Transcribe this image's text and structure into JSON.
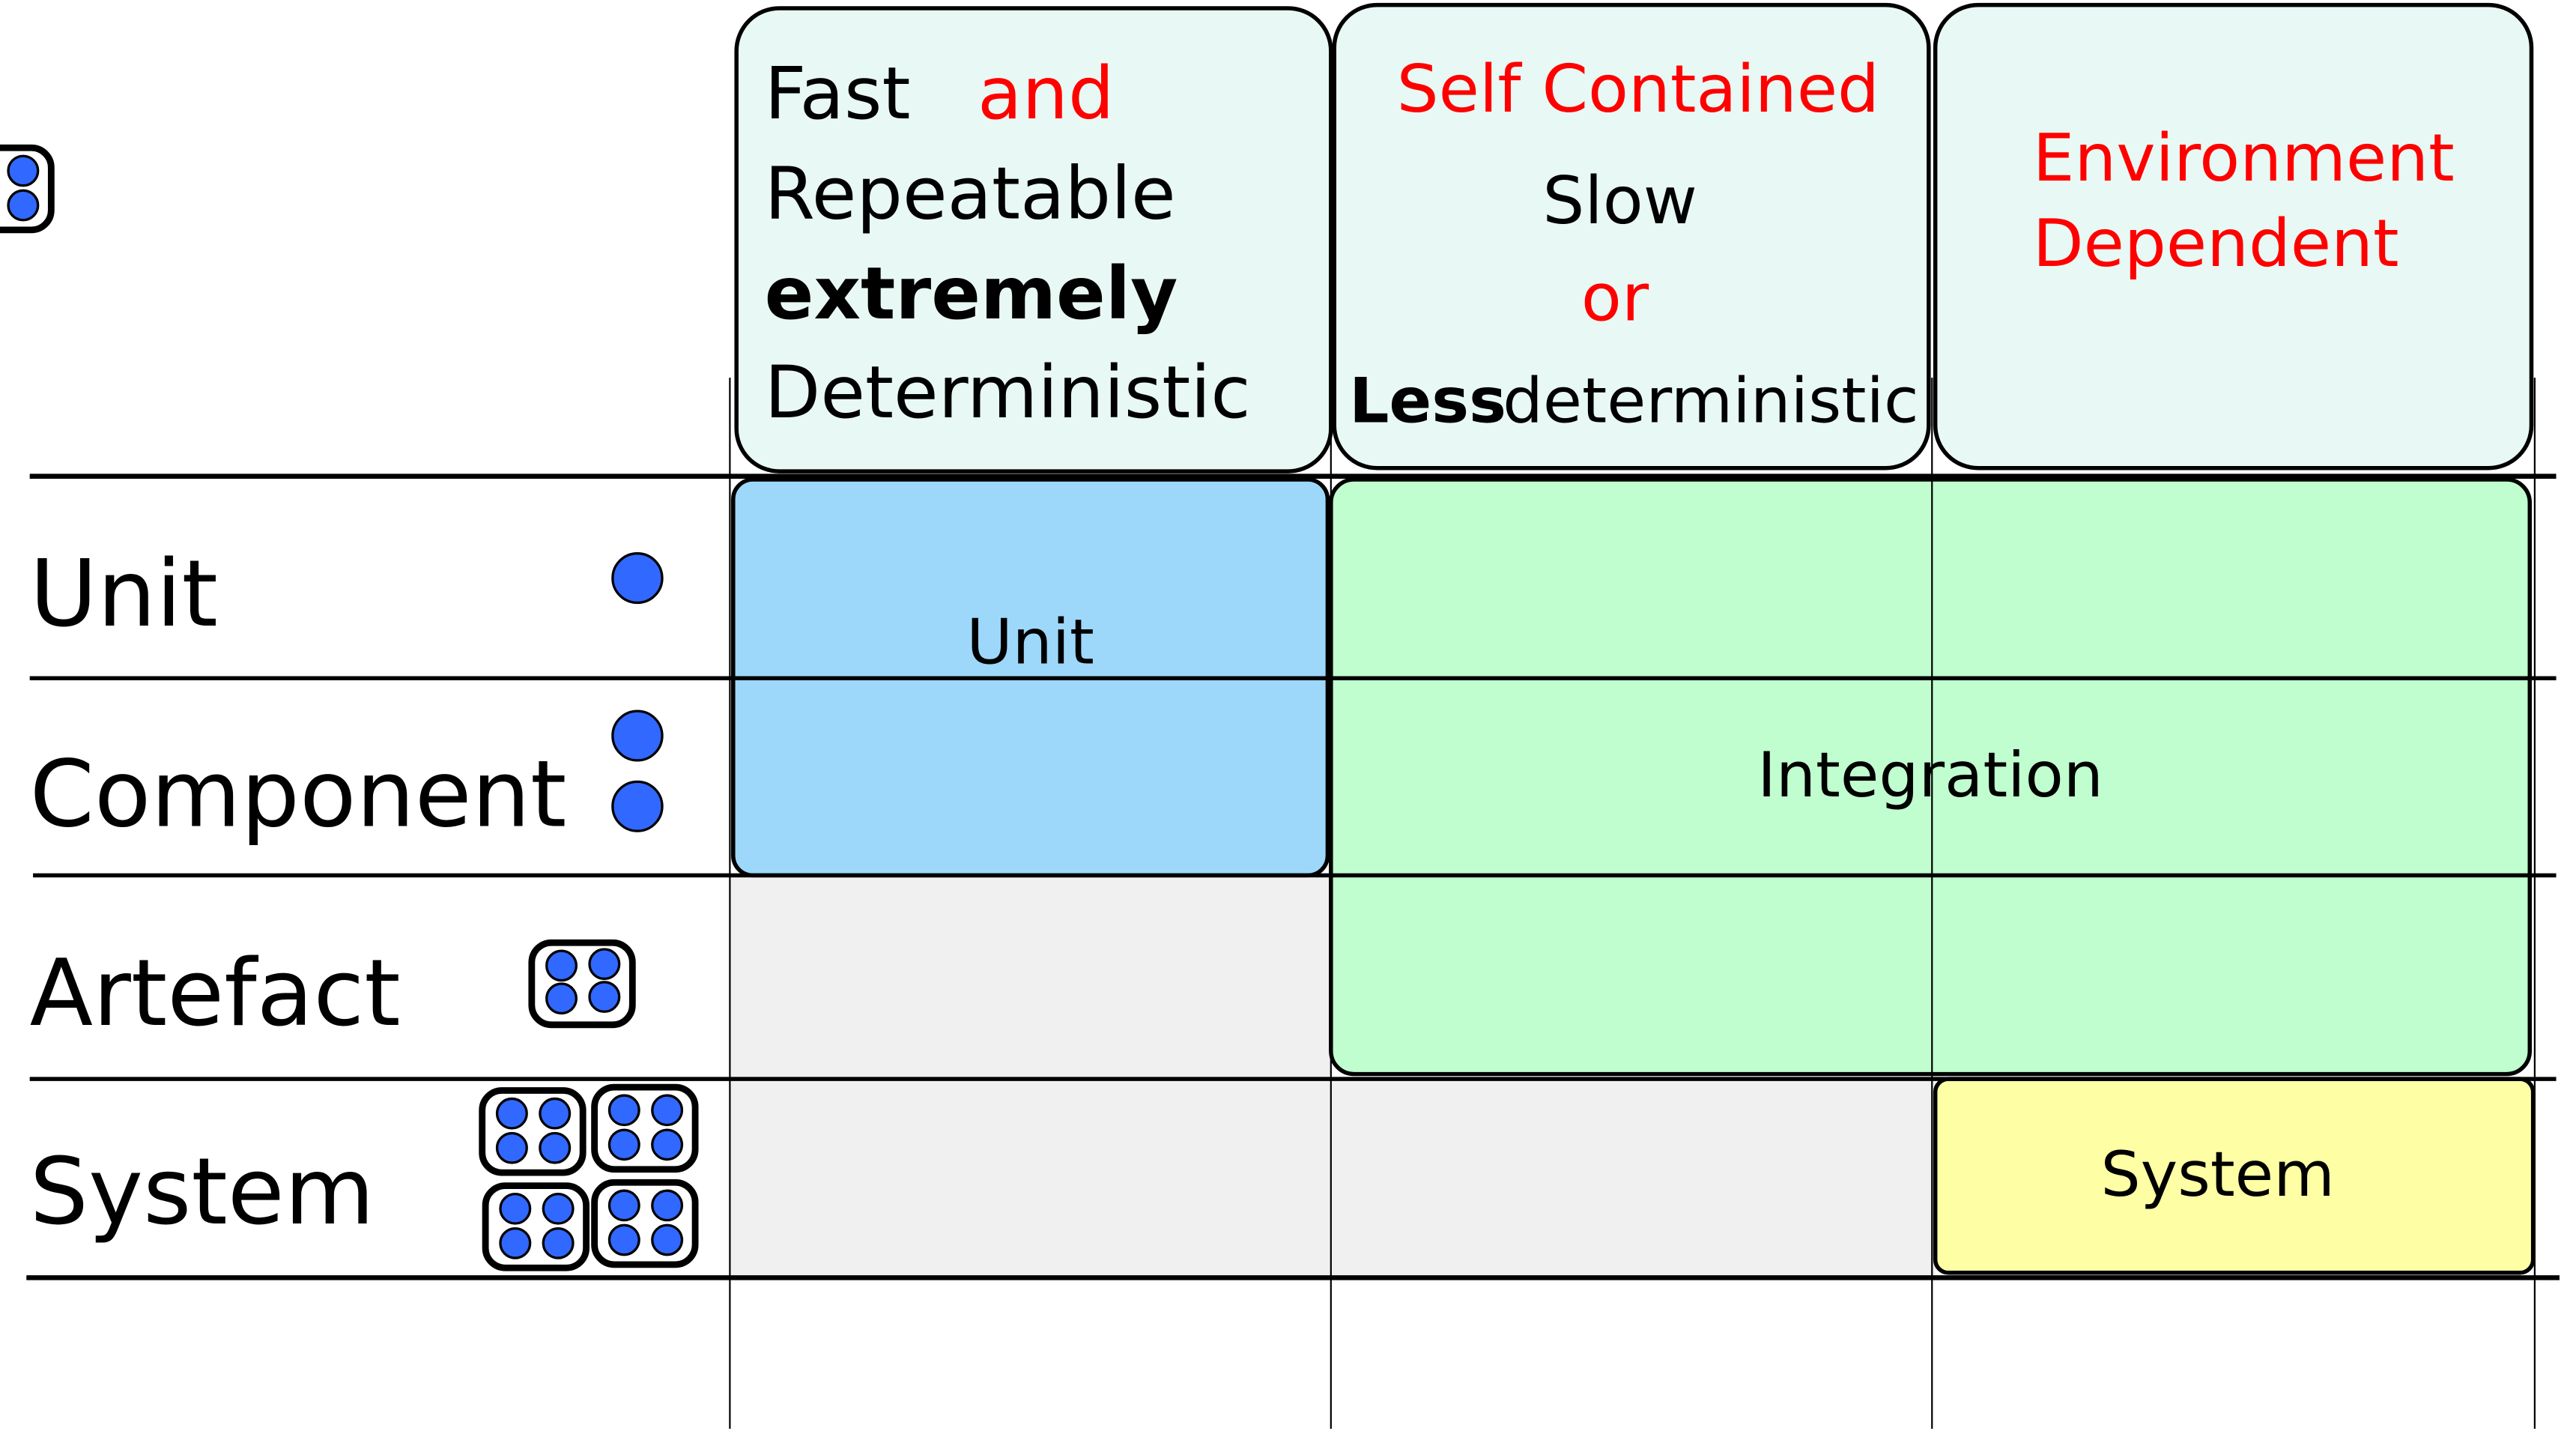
{
  "columns": [
    {
      "lines": [
        {
          "parts": [
            "Fast",
            "and"
          ]
        },
        {
          "parts": [
            "Repeatable"
          ]
        },
        {
          "parts": [
            "extremely"
          ]
        },
        {
          "parts": [
            "Deterministic"
          ]
        }
      ]
    },
    {
      "lines": [
        {
          "parts": [
            "Self Contained"
          ]
        },
        {
          "parts": [
            "Slow"
          ]
        },
        {
          "parts": [
            "or"
          ]
        },
        {
          "parts": [
            "Less",
            "deterministic"
          ]
        }
      ]
    },
    {
      "lines": [
        {
          "parts": [
            "Environment"
          ]
        },
        {
          "parts": [
            "Dependent"
          ]
        }
      ]
    }
  ],
  "rows": [
    {
      "label": "Unit",
      "icon": "single-dot-icon"
    },
    {
      "label": "Component",
      "icon": "two-dots-icon"
    },
    {
      "label": "Artefact",
      "icon": "four-dot-box-icon"
    },
    {
      "label": "System",
      "icon": "four-boxes-icon"
    }
  ],
  "regions": {
    "unit": "Unit",
    "integration": "Integration",
    "system": "System"
  },
  "colors": {
    "accent_red": "#ff0000",
    "header_fill": "#e8f8f4",
    "unit_fill": "#9dd8fb",
    "integration_fill": "#c0fecf",
    "system_fill": "#fefea5",
    "empty_fill": "#f0f0f0",
    "dot_fill": "#3168ff"
  }
}
